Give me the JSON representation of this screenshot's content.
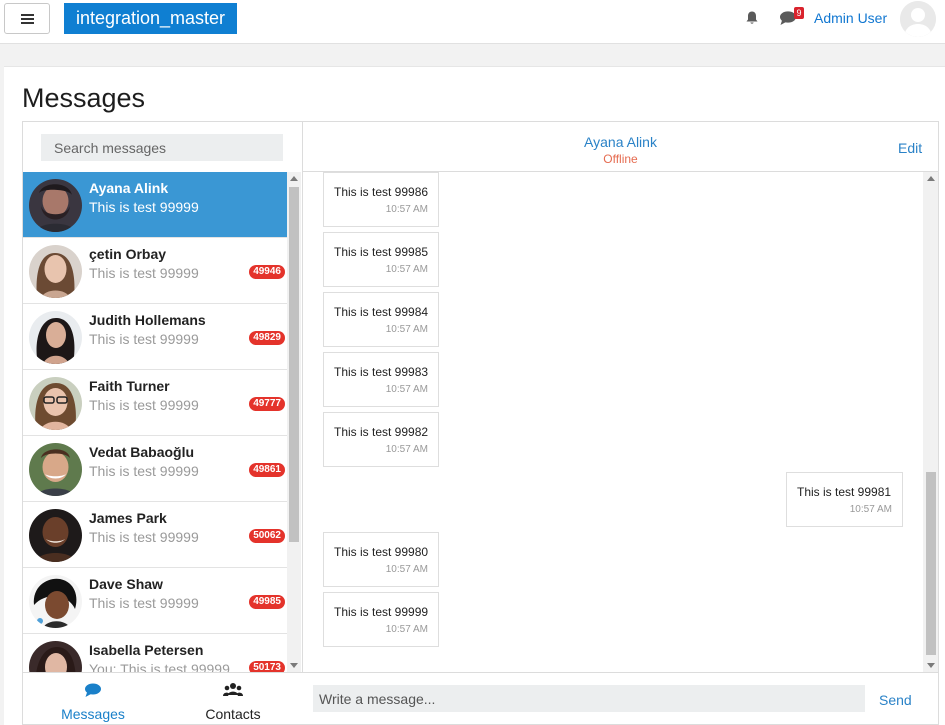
{
  "navbar": {
    "brand": "integration_master",
    "chat_badge_count": "9",
    "user_name": "Admin User"
  },
  "page": {
    "title": "Messages"
  },
  "search": {
    "placeholder": "Search messages"
  },
  "conversations": [
    {
      "name": "Ayana Alink",
      "preview": "This is test 99999",
      "unread": "",
      "active": true
    },
    {
      "name": "çetin Orbay",
      "preview": "This is test 99999",
      "unread": "49946",
      "active": false
    },
    {
      "name": "Judith Hollemans",
      "preview": "This is test 99999",
      "unread": "49829",
      "active": false
    },
    {
      "name": "Faith Turner",
      "preview": "This is test 99999",
      "unread": "49777",
      "active": false
    },
    {
      "name": "Vedat Babaoğlu",
      "preview": "This is test 99999",
      "unread": "49861",
      "active": false
    },
    {
      "name": "James Park",
      "preview": "This is test 99999",
      "unread": "50062",
      "active": false
    },
    {
      "name": "Dave Shaw",
      "preview": "This is test 99999",
      "unread": "49985",
      "active": false
    },
    {
      "name": "Isabella Petersen",
      "preview": "You: This is test 99999",
      "unread": "50173",
      "active": false
    }
  ],
  "footer_tabs": {
    "messages": "Messages",
    "contacts": "Contacts"
  },
  "chat": {
    "contact_name": "Ayana Alink",
    "status": "Offline",
    "edit_label": "Edit",
    "messages": [
      {
        "text": "This is test 99986",
        "time": "10:57 AM",
        "outgoing": false
      },
      {
        "text": "This is test 99985",
        "time": "10:57 AM",
        "outgoing": false
      },
      {
        "text": "This is test 99984",
        "time": "10:57 AM",
        "outgoing": false
      },
      {
        "text": "This is test 99983",
        "time": "10:57 AM",
        "outgoing": false
      },
      {
        "text": "This is test 99982",
        "time": "10:57 AM",
        "outgoing": false
      },
      {
        "text": "This is test 99981",
        "time": "10:57 AM",
        "outgoing": true
      },
      {
        "text": "This is test 99980",
        "time": "10:57 AM",
        "outgoing": false
      },
      {
        "text": "This is test 99999",
        "time": "10:57 AM",
        "outgoing": false
      }
    ],
    "input_placeholder": "Write a message...",
    "send_label": "Send"
  },
  "colors": {
    "brand": "#0f7fd2",
    "active_conversation": "#3a97d4",
    "link": "#2a82c7",
    "badge": "#e4332b",
    "offline": "#e56b50"
  },
  "icons": {
    "menu": "hamburger-icon",
    "notifications": "bell-icon",
    "messages": "chat-bubble-icon",
    "contacts": "users-icon",
    "avatar_default": "user-silhouette-icon"
  }
}
